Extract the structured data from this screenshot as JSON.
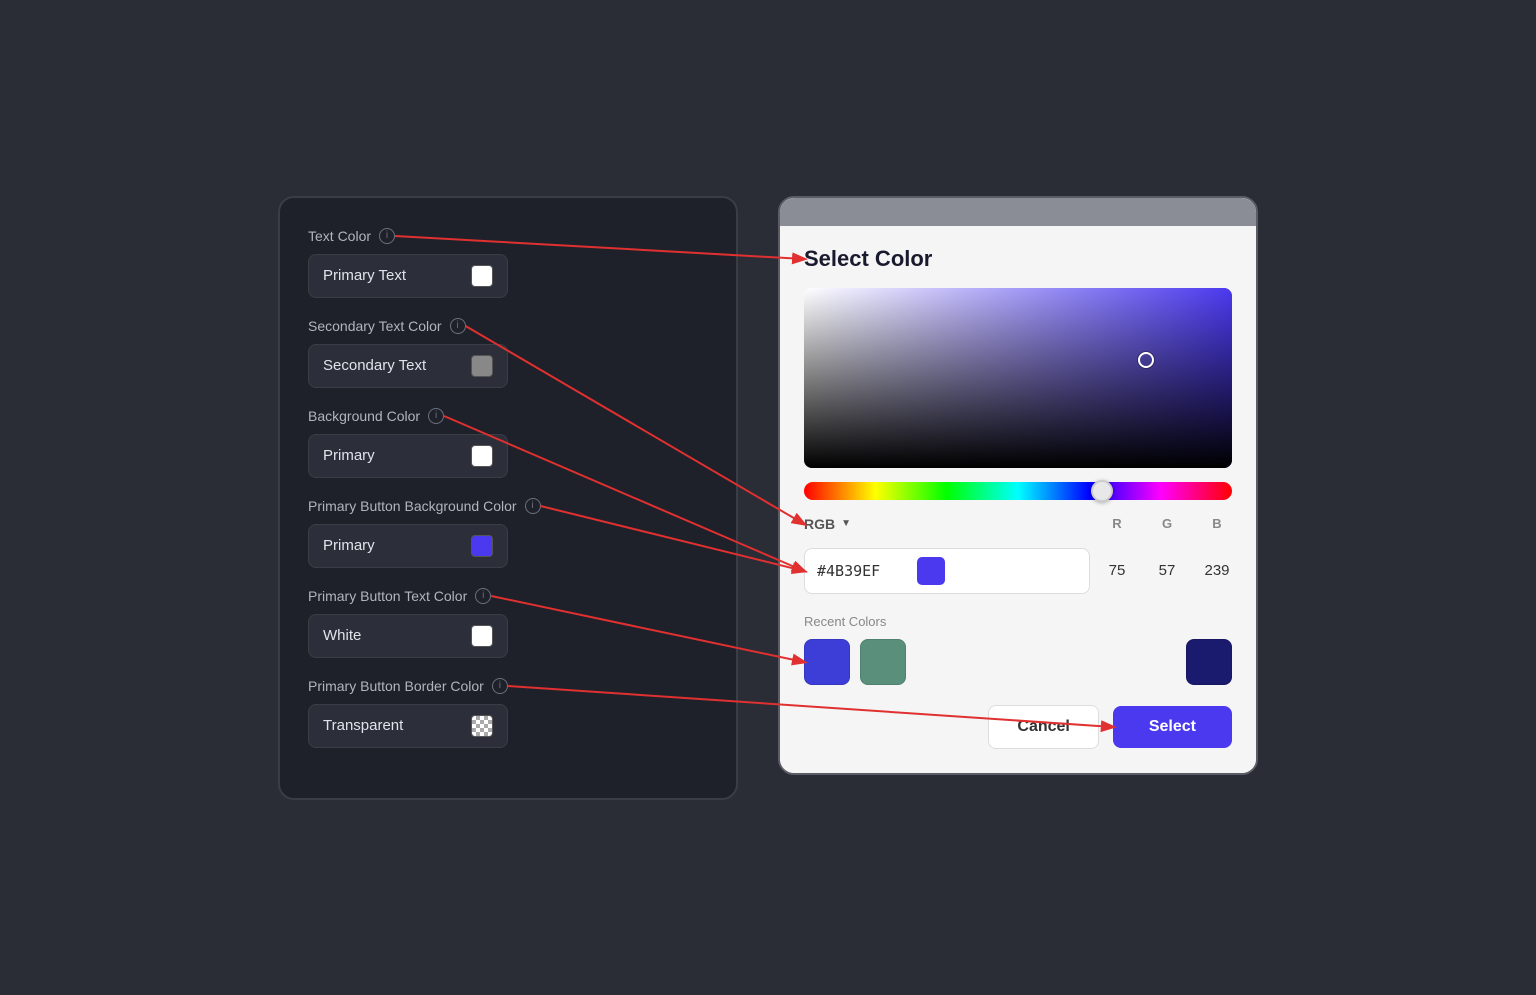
{
  "leftPanel": {
    "sections": [
      {
        "id": "text-color",
        "label": "Text Color",
        "button": {
          "text": "Primary Text",
          "swatchClass": "swatch-white"
        }
      },
      {
        "id": "secondary-text-color",
        "label": "Secondary Text Color",
        "button": {
          "text": "Secondary Text",
          "swatchClass": "swatch-gray"
        }
      },
      {
        "id": "background-color",
        "label": "Background Color",
        "button": {
          "text": "Primary",
          "swatchClass": "swatch-white"
        }
      },
      {
        "id": "primary-button-bg-color",
        "label": "Primary Button Background Color",
        "button": {
          "text": "Primary",
          "swatchClass": "swatch-purple"
        }
      },
      {
        "id": "primary-button-text-color",
        "label": "Primary Button Text Color",
        "button": {
          "text": "White",
          "swatchClass": "swatch-white"
        }
      },
      {
        "id": "primary-button-border-color",
        "label": "Primary Button Border Color",
        "button": {
          "text": "Transparent",
          "swatchClass": "swatch-transparent"
        }
      }
    ]
  },
  "colorPicker": {
    "title": "Select Color",
    "hexValue": "#4B39EF",
    "rgbMode": "RGB",
    "r": 75,
    "g": 57,
    "b": 239,
    "recentColors": [
      "#3D3DD8",
      "#5A8F7B",
      "#1A1A6E"
    ],
    "cancelLabel": "Cancel",
    "selectLabel": "Select"
  }
}
